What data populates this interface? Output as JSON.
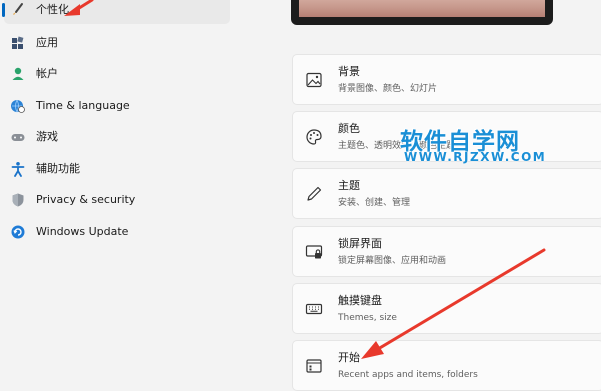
{
  "sidebar": {
    "items": [
      {
        "label": "个性化",
        "icon": "brush-icon",
        "active": true
      },
      {
        "label": "应用",
        "icon": "apps-icon"
      },
      {
        "label": "帐户",
        "icon": "account-icon"
      },
      {
        "label": "Time & language",
        "icon": "globe-clock-icon"
      },
      {
        "label": "游戏",
        "icon": "gamepad-icon"
      },
      {
        "label": "辅助功能",
        "icon": "accessibility-icon"
      },
      {
        "label": "Privacy & security",
        "icon": "shield-icon"
      },
      {
        "label": "Windows Update",
        "icon": "update-icon"
      }
    ]
  },
  "cards": [
    {
      "title": "背景",
      "desc": "背景图像、颜色、幻灯片",
      "icon": "image-icon"
    },
    {
      "title": "颜色",
      "desc": "主题色、透明效果、颜色主题",
      "icon": "palette-icon"
    },
    {
      "title": "主题",
      "desc": "安装、创建、管理",
      "icon": "pen-icon"
    },
    {
      "title": "锁屏界面",
      "desc": "锁定屏幕图像、应用和动画",
      "icon": "lock-screen-icon"
    },
    {
      "title": "触摸键盘",
      "desc": "Themes, size",
      "icon": "keyboard-icon"
    },
    {
      "title": "开始",
      "desc": "Recent apps and items, folders",
      "icon": "start-icon"
    }
  ],
  "watermark": {
    "title": "软件自学网",
    "url": "WWW.RJZXW.COM"
  },
  "colors": {
    "accent": "#0067c0",
    "annotation_arrow": "#e8392c",
    "watermark": "#1a8fd6"
  }
}
